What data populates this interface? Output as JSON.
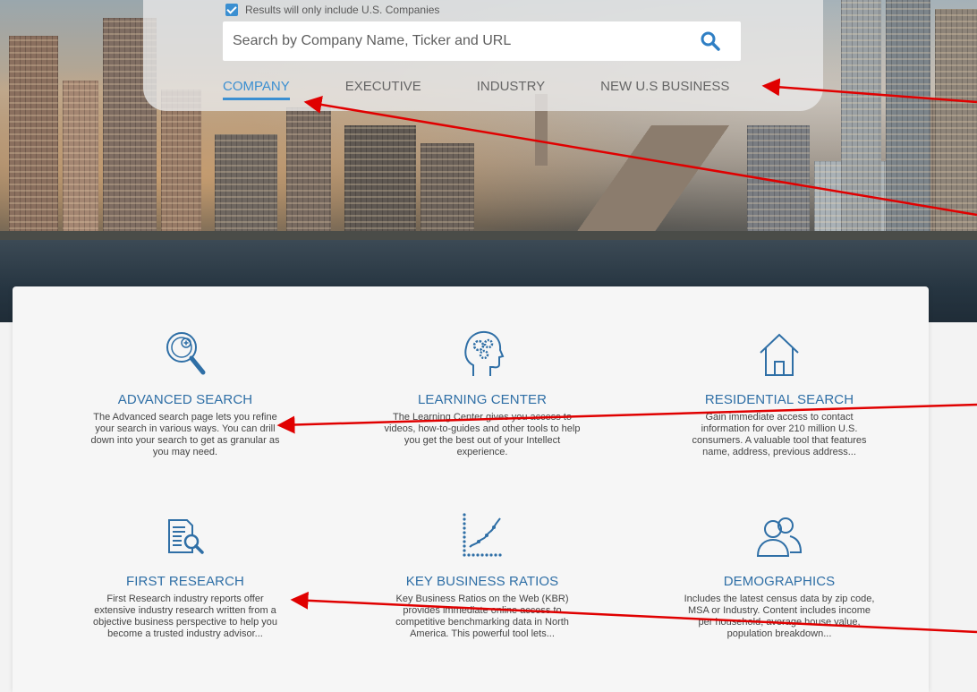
{
  "search": {
    "filter_label": "Results will only include U.S. Companies",
    "filter_checked": true,
    "placeholder": "Search by Company Name, Ticker and URL",
    "value": ""
  },
  "tabs": [
    {
      "label": "COMPANY",
      "active": true
    },
    {
      "label": "EXECUTIVE",
      "active": false
    },
    {
      "label": "INDUSTRY",
      "active": false
    },
    {
      "label": "NEW U.S BUSINESS",
      "active": false
    }
  ],
  "features": [
    {
      "icon": "magnifier-icon",
      "title": "ADVANCED SEARCH",
      "desc": "The Advanced search page lets you refine your search in various ways. You can drill down into your search to get as granular as you may need."
    },
    {
      "icon": "head-gears-icon",
      "title": "LEARNING CENTER",
      "desc": "The Learning Center gives you access to videos, how-to-guides and other tools to help you get the best out of your Intellect experience."
    },
    {
      "icon": "house-icon",
      "title": "RESIDENTIAL SEARCH",
      "desc": "Gain immediate access to contact information for over 210 million U.S. consumers. A valuable tool that features name, address, previous address..."
    },
    {
      "icon": "report-search-icon",
      "title": "FIRST RESEARCH",
      "desc": "First Research industry reports offer extensive industry research written from a objective business perspective to help you become a trusted industry advisor..."
    },
    {
      "icon": "trend-chart-icon",
      "title": "KEY BUSINESS RATIOS",
      "desc": "Key Business Ratios on the Web (KBR) provides immediate online access to competitive benchmarking data in North America. This powerful tool lets..."
    },
    {
      "icon": "people-icon",
      "title": "DEMOGRAPHICS",
      "desc": "Includes the latest census data by zip code, MSA or Industry. Content includes income per household, average house value, population breakdown..."
    }
  ],
  "colors": {
    "accent": "#3b8fd1",
    "feature_title": "#2f6fa6",
    "annotation_arrow": "#e00000"
  }
}
